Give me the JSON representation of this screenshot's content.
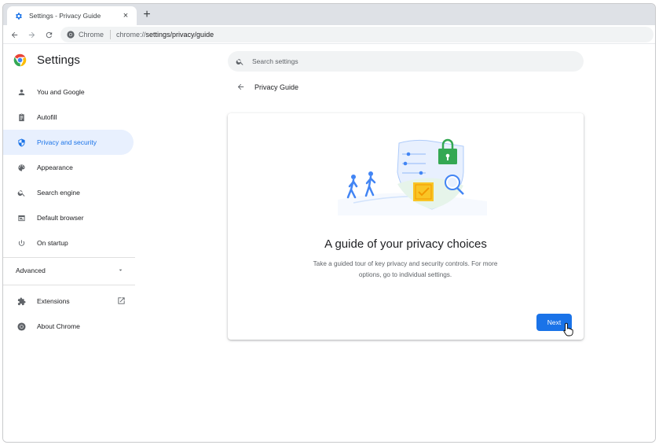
{
  "browser": {
    "tab": {
      "title": "Settings - Privacy Guide",
      "close_icon": "×"
    },
    "new_tab_icon": "+",
    "omnibox": {
      "site_label": "Chrome",
      "url_prefix": "chrome://",
      "url_rest": "settings/privacy/guide"
    }
  },
  "settings": {
    "title": "Settings",
    "search_placeholder": "Search settings",
    "sidebar": {
      "items": [
        {
          "label": "You and Google",
          "icon": "person-icon"
        },
        {
          "label": "Autofill",
          "icon": "clipboard-icon"
        },
        {
          "label": "Privacy and security",
          "icon": "shield-icon",
          "active": true
        },
        {
          "label": "Appearance",
          "icon": "palette-icon"
        },
        {
          "label": "Search engine",
          "icon": "search-icon"
        },
        {
          "label": "Default browser",
          "icon": "browser-icon"
        },
        {
          "label": "On startup",
          "icon": "power-icon"
        }
      ],
      "advanced_label": "Advanced",
      "extensions_label": "Extensions",
      "about_label": "About Chrome"
    }
  },
  "privacy_guide": {
    "header_title": "Privacy Guide",
    "heading": "A guide of your privacy choices",
    "description": "Take a guided tour of key privacy and security controls. For more options, go to individual settings.",
    "next_label": "Next"
  },
  "colors": {
    "accent": "#1a73e8",
    "active_bg": "#e8f0fe",
    "lock_green": "#34a853",
    "check_yellow": "#fbbc04"
  }
}
